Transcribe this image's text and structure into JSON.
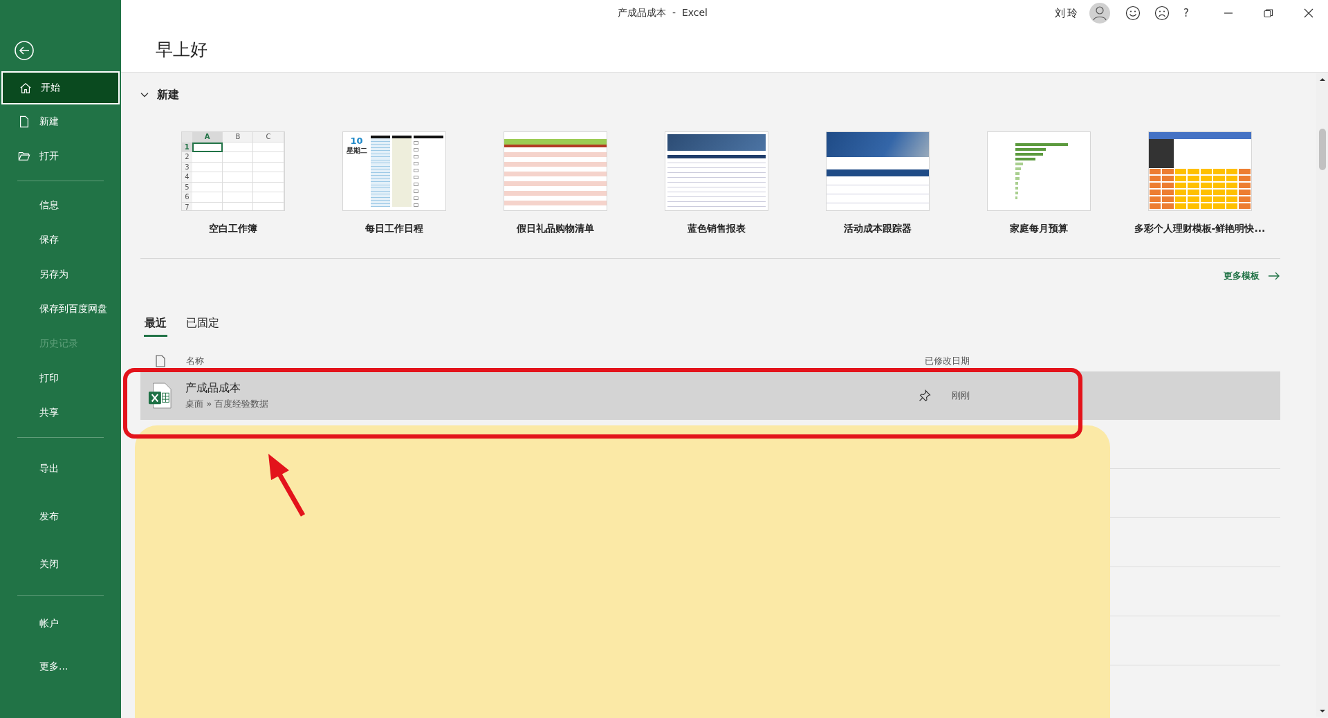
{
  "window": {
    "title": "产成品成本",
    "app": "Excel",
    "separator": "-",
    "user": "刘玲",
    "help": "?"
  },
  "sidebar": {
    "sections": [
      {
        "items": [
          {
            "label": "开始",
            "selected": true,
            "disabled": false
          },
          {
            "label": "新建",
            "selected": false,
            "disabled": false
          },
          {
            "label": "打开",
            "selected": false,
            "disabled": false
          }
        ]
      },
      {
        "items": [
          {
            "label": "信息",
            "selected": false,
            "disabled": false
          },
          {
            "label": "保存",
            "selected": false,
            "disabled": false
          },
          {
            "label": "另存为",
            "selected": false,
            "disabled": false
          },
          {
            "label": "保存到百度网盘",
            "selected": false,
            "disabled": false
          },
          {
            "label": "历史记录",
            "selected": false,
            "disabled": true
          },
          {
            "label": "打印",
            "selected": false,
            "disabled": false
          },
          {
            "label": "共享",
            "selected": false,
            "disabled": false
          }
        ]
      },
      {
        "items": [
          {
            "label": "导出",
            "selected": false,
            "disabled": false
          },
          {
            "label": "发布",
            "selected": false,
            "disabled": false
          },
          {
            "label": "关闭",
            "selected": false,
            "disabled": false
          }
        ]
      },
      {
        "items": [
          {
            "label": "帐户",
            "selected": false,
            "disabled": false
          },
          {
            "label": "更多...",
            "selected": false,
            "disabled": false
          }
        ]
      }
    ]
  },
  "greeting": "早上好",
  "new_section": {
    "title": "新建",
    "expanded": true,
    "templates": [
      {
        "label": "空白工作簿",
        "kind": "blank",
        "columns": [
          "A",
          "B",
          "C"
        ],
        "rows": [
          "1",
          "2",
          "3",
          "4",
          "5",
          "6",
          "7"
        ]
      },
      {
        "label": "每日工作日程",
        "kind": "schedule",
        "day": "10",
        "weekday": "星期二"
      },
      {
        "label": "假日礼品购物清单",
        "kind": "list"
      },
      {
        "label": "蓝色销售报表",
        "kind": "report"
      },
      {
        "label": "活动成本跟踪器",
        "kind": "tracker"
      },
      {
        "label": "家庭每月预算",
        "kind": "barchart"
      },
      {
        "label": "多彩个人理财模板-鲜艳明快...",
        "kind": "colorful"
      }
    ],
    "more_link": "更多模板"
  },
  "recent": {
    "tabs": [
      {
        "label": "最近",
        "selected": true
      },
      {
        "label": "已固定",
        "selected": false
      }
    ],
    "columns": [
      "名称",
      "已修改日期"
    ],
    "files": [
      {
        "name": "产成品成本",
        "path": "桌面 » 百度经验数据",
        "modified": "刚刚",
        "selected": true
      }
    ]
  },
  "annotations": [
    {
      "kind": "highlight"
    },
    {
      "kind": "box"
    },
    {
      "kind": "arrow"
    }
  ]
}
